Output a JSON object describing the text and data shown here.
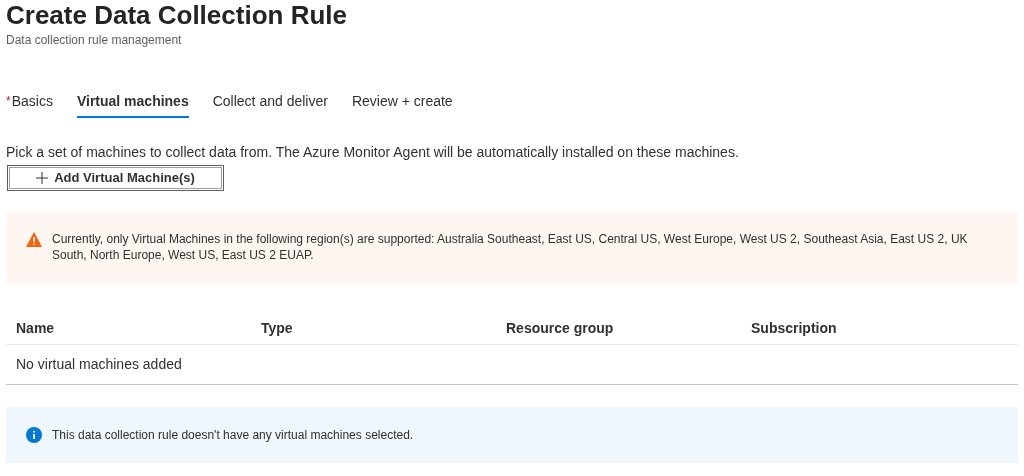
{
  "header": {
    "title": "Create Data Collection Rule",
    "subtitle": "Data collection rule management"
  },
  "tabs": [
    {
      "label": "Basics",
      "required_mark": "*",
      "selected": false
    },
    {
      "label": "Virtual machines",
      "selected": true
    },
    {
      "label": "Collect and deliver",
      "selected": false
    },
    {
      "label": "Review + create",
      "selected": false
    }
  ],
  "description": "Pick a set of machines to collect data from. The Azure Monitor Agent will be automatically installed on these machines.",
  "add_button": {
    "label": "Add Virtual Machine(s)"
  },
  "warning": {
    "text": "Currently, only Virtual Machines in the following region(s) are supported: Australia Southeast, East US, Central US, West Europe, West US 2, Southeast Asia, East US 2, UK South, North Europe, West US, East US 2 EUAP."
  },
  "table": {
    "columns": [
      "Name",
      "Type",
      "Resource group",
      "Subscription"
    ],
    "empty_message": "No virtual machines added"
  },
  "info": {
    "text": "This data collection rule doesn't have any virtual machines selected."
  }
}
